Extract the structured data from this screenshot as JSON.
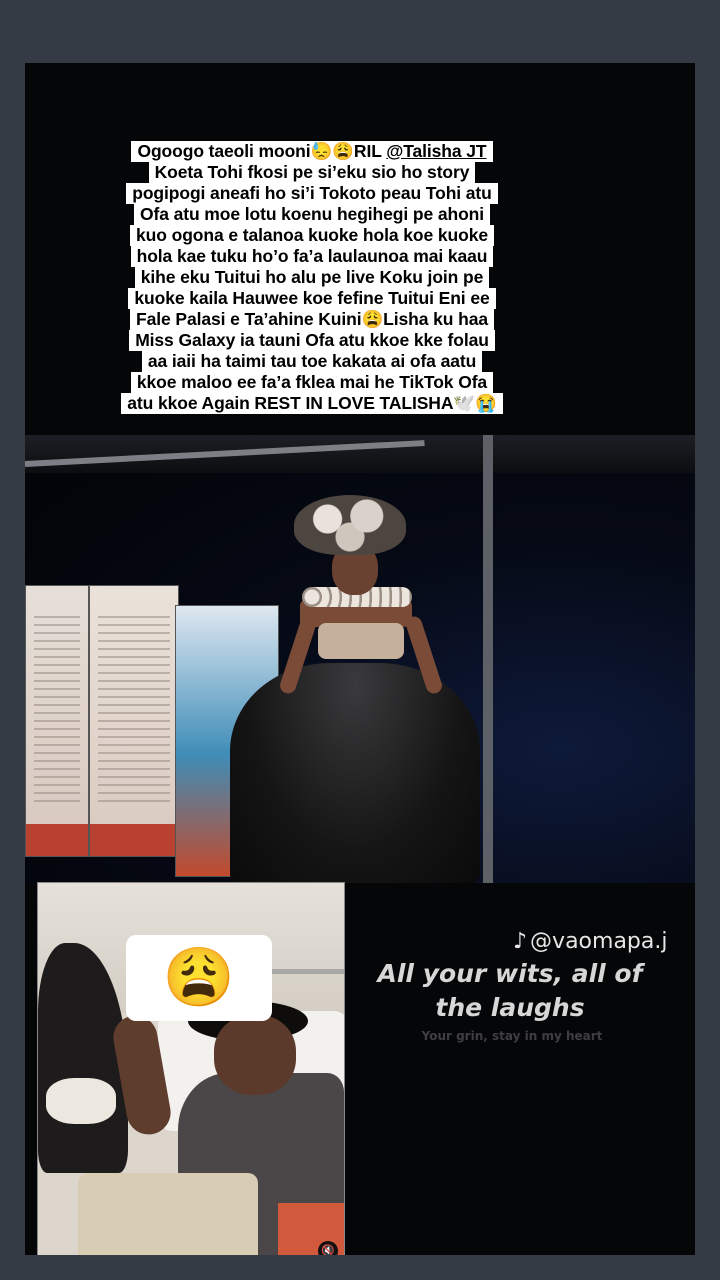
{
  "caption": {
    "lines": [
      "Ogoogo taeoli mooni😓😩RIL @Talisha JT",
      "Koeta Tohi fkosi pe si’eku sio ho story",
      "pogipogi aneafi ho si’i Tokoto peau Tohi atu",
      "Ofa atu moe lotu koenu hegihegi pe ahoni",
      "kuo ogona e talanoa kuoke hola koe kuoke",
      "hola kae tuku ho’o fa’a laulaunoa mai kaau",
      "kihe eku Tuitui ho alu pe live Koku join pe",
      "kuoke kaila Hauwee koe fefine Tuitui Eni ee",
      "Fale Palasi e Ta’ahine Kuini😩Lisha ku haa",
      "Miss Galaxy ia tauni Ofa atu kkoe kke folau",
      "aa iaii ha taimi tau toe kakata ai ofa aatu",
      "kkoe maloo ee fa’a fklea mai he TikTok Ofa",
      "atu kkoe Again REST IN LOVE TALISHA🕊️😭"
    ],
    "line1_prefix": "Ogoogo taeoli mooni😓😩RIL ",
    "mention": "@Talisha JT"
  },
  "inset": {
    "emoji": "😩",
    "mute_icon": "🔇"
  },
  "tiktok": {
    "icon": "♪",
    "handle": "@vaomapa.j",
    "lyric_main": "All your wits, all of the laughs",
    "lyric_sub": "Your grin, stay in my heart"
  },
  "colors": {
    "background": "#343b44",
    "story_bg": "#050608",
    "caption_bg": "#ffffff"
  }
}
